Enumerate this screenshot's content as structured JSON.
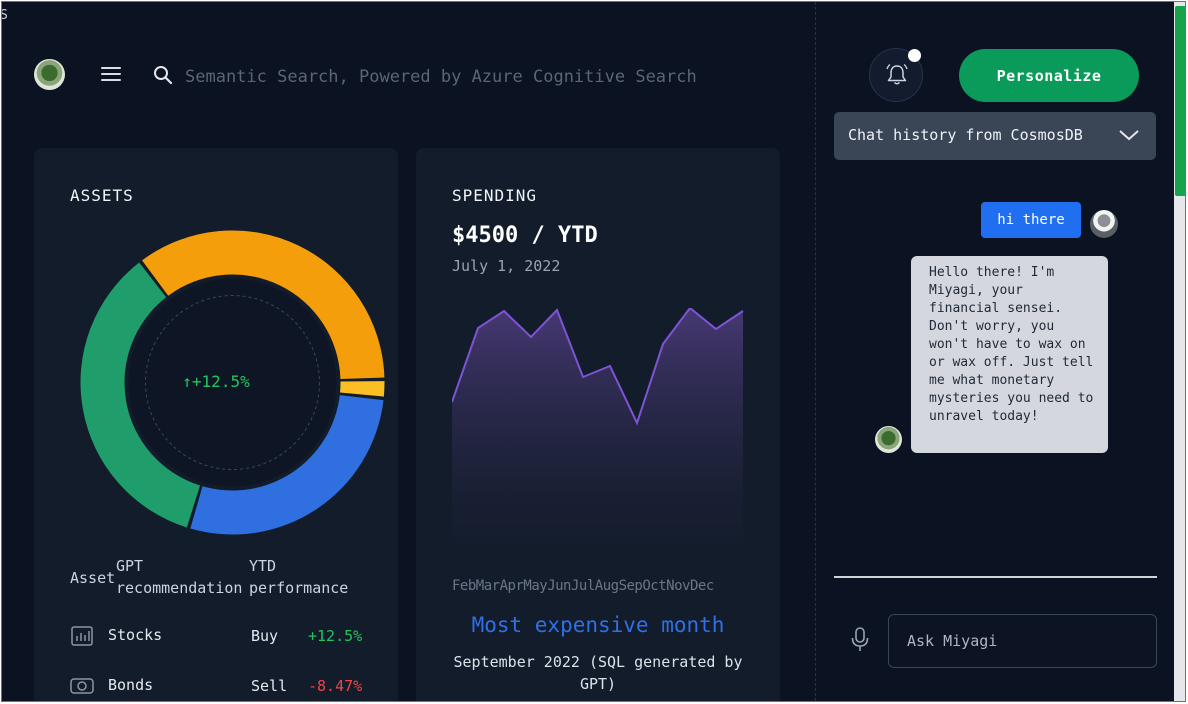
{
  "corner_glyph": "S",
  "header": {
    "search_placeholder": "Semantic Search, Powered by Azure Cognitive Search",
    "personalize_label": "Personalize",
    "chat_history_label": "Chat history from CosmosDB"
  },
  "assets": {
    "title": "ASSETS",
    "gain_label": "↑+12.5%",
    "donut_segments": [
      {
        "name": "orange",
        "color": "#f59e0b",
        "fraction": 0.35
      },
      {
        "name": "yellow",
        "color": "#fbbf24",
        "fraction": 0.02
      },
      {
        "name": "blue",
        "color": "#2f6fdf",
        "fraction": 0.28
      },
      {
        "name": "green",
        "color": "#1f9d6b",
        "fraction": 0.35
      }
    ],
    "columns": {
      "asset": "Asset",
      "gpt_line1": "GPT",
      "gpt_line2": "recommendation",
      "ytd_line1": "YTD",
      "ytd_line2": "performance"
    },
    "rows": [
      {
        "name": "Stocks",
        "recommendation": "Buy",
        "performance": "+12.5%",
        "icon": "chart-icon"
      },
      {
        "name": "Bonds",
        "recommendation": "Sell",
        "performance": "-8.47%",
        "icon": "cash-icon"
      }
    ]
  },
  "spending": {
    "title": "SPENDING",
    "amount": "$4500 / YTD",
    "date": "July 1, 2022",
    "months": [
      "Feb",
      "Mar",
      "Apr",
      "May",
      "Jun",
      "Jul",
      "Aug",
      "Sep",
      "Oct",
      "Nov",
      "Dec"
    ],
    "most_expensive_title": "Most expensive month",
    "most_expensive_desc": "September 2022 (SQL generated by GPT)"
  },
  "chat": {
    "user_message": "hi there",
    "bot_message": "Hello there! I'm Miyagi, your financial sensei. Don't worry, you won't have to wax on or wax off. Just tell me what monetary mysteries you need to unravel today!",
    "ask_placeholder": "Ask Miyagi"
  }
}
